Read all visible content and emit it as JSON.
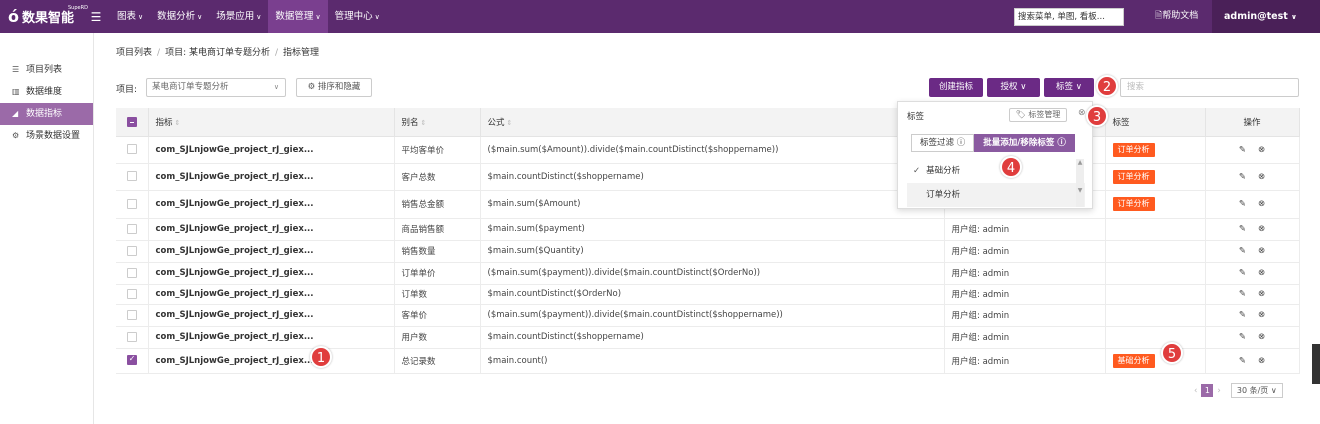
{
  "brand": {
    "name": "数果智能",
    "super": "SupeRD"
  },
  "nav": [
    {
      "label": "图表",
      "caret": "∨"
    },
    {
      "label": "数据分析",
      "caret": "∨"
    },
    {
      "label": "场景应用",
      "caret": "∨"
    },
    {
      "label": "数据管理",
      "caret": "∨",
      "active": true
    },
    {
      "label": "管理中心",
      "caret": "∨"
    }
  ],
  "top_search": {
    "placeholder": "搜索菜单, 单图, 看板..."
  },
  "help": "帮助文档",
  "user": "admin@test",
  "sidebar": {
    "items": [
      {
        "label": "项目列表",
        "icon": "list-icon"
      },
      {
        "label": "数据维度",
        "icon": "bar-chart-icon"
      },
      {
        "label": "数据指标",
        "icon": "area-chart-icon",
        "active": true
      },
      {
        "label": "场景数据设置",
        "icon": "gear-icon"
      }
    ]
  },
  "breadcrumb": [
    "项目列表",
    "项目: 某电商订单专题分析",
    "指标管理"
  ],
  "toolbar": {
    "project_label": "项目:",
    "project_value": "某电商订单专题分析",
    "sort_hide": "排序和隐藏",
    "create": "创建指标",
    "auth": "授权",
    "tag": "标签",
    "search_placeholder": "搜索"
  },
  "table": {
    "headers": {
      "name": "指标",
      "alias": "别名",
      "formula": "公式",
      "tags": "标签",
      "ops": "操作"
    },
    "rows": [
      {
        "name": "com_SJLnjowGe_project_rJ_giex...",
        "alias": "平均客单价",
        "formula": "($main.sum($Amount)).divide($main.countDistinct($shoppername))",
        "perm": "",
        "tag": "订单分析",
        "checked": false
      },
      {
        "name": "com_SJLnjowGe_project_rJ_giex...",
        "alias": "客户总数",
        "formula": "$main.countDistinct($shoppername)",
        "perm": "",
        "tag": "订单分析",
        "checked": false
      },
      {
        "name": "com_SJLnjowGe_project_rJ_giex...",
        "alias": "销售总金额",
        "formula": "$main.sum($Amount)",
        "perm": "",
        "tag": "订单分析",
        "checked": false
      },
      {
        "name": "com_SJLnjowGe_project_rJ_giex...",
        "alias": "商品销售额",
        "formula": "$main.sum($payment)",
        "perm": "用户组: admin",
        "tag": "",
        "checked": false
      },
      {
        "name": "com_SJLnjowGe_project_rJ_giex...",
        "alias": "销售数量",
        "formula": "$main.sum($Quantity)",
        "perm": "用户组: admin",
        "tag": "",
        "checked": false
      },
      {
        "name": "com_SJLnjowGe_project_rJ_giex...",
        "alias": "订单单价",
        "formula": "($main.sum($payment)).divide($main.countDistinct($OrderNo))",
        "perm": "用户组: admin",
        "tag": "",
        "checked": false
      },
      {
        "name": "com_SJLnjowGe_project_rJ_giex...",
        "alias": "订单数",
        "formula": "$main.countDistinct($OrderNo)",
        "perm": "用户组: admin",
        "tag": "",
        "checked": false
      },
      {
        "name": "com_SJLnjowGe_project_rJ_giex...",
        "alias": "客单价",
        "formula": "($main.sum($payment)).divide($main.countDistinct($shoppername))",
        "perm": "用户组: admin",
        "tag": "",
        "checked": false
      },
      {
        "name": "com_SJLnjowGe_project_rJ_giex...",
        "alias": "用户数",
        "formula": "$main.countDistinct($shoppername)",
        "perm": "用户组: admin",
        "tag": "",
        "checked": false
      },
      {
        "name": "com_SJLnjowGe_project_rJ_giex...",
        "alias": "总记录数",
        "formula": "$main.count()",
        "perm": "用户组: admin",
        "tag": "基础分析",
        "checked": true
      }
    ]
  },
  "tag_dropdown": {
    "title": "标签",
    "manage": "标签管理",
    "tab_filter": "标签过滤",
    "tab_batch": "批量添加/移除标签",
    "items": [
      {
        "label": "基础分析",
        "checked": true
      },
      {
        "label": "订单分析",
        "checked": false
      }
    ]
  },
  "markers": [
    "1",
    "2",
    "3",
    "4",
    "5"
  ],
  "pager": {
    "current": "1",
    "page_size": "30 条/页"
  }
}
